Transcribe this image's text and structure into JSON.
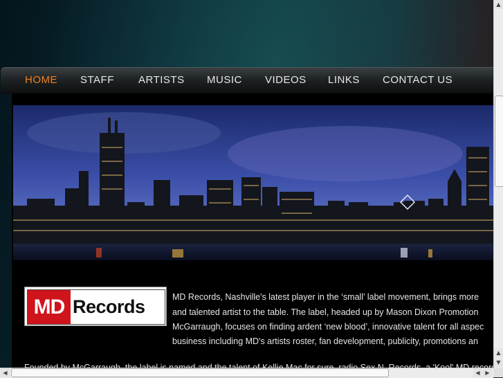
{
  "nav": {
    "items": [
      {
        "label": "HOME",
        "active": true
      },
      {
        "label": "STAFF"
      },
      {
        "label": "ARTISTS"
      },
      {
        "label": "MUSIC"
      },
      {
        "label": "VIDEOS"
      },
      {
        "label": "LINKS"
      },
      {
        "label": "CONTACT US"
      }
    ],
    "active_color": "#f08020"
  },
  "logo": {
    "part1": "MD",
    "part2": "Records",
    "brand_red": "#d0141c"
  },
  "intro": {
    "lines": [
      "MD Records, Nashville's latest player in the ‘small’ label movement, brings more",
      "and talented artist to the table.  The label, headed up by Mason Dixon Promotion",
      "McGarraugh, focuses on finding ardent ‘new blood’, innovative talent for all aspec",
      "business including MD's artists roster, fan development,  publicity, promotions an"
    ],
    "second_paragraph": "Founded by McGarraugh, the label is named and the talent of Kellie Mac for sure, radio Sex N. Records, a 'Kool' MD record"
  },
  "scrollbars": {
    "up_arrow": "▲",
    "down_arrow": "▼",
    "left_arrow": "◀",
    "right_arrow": "▶"
  }
}
